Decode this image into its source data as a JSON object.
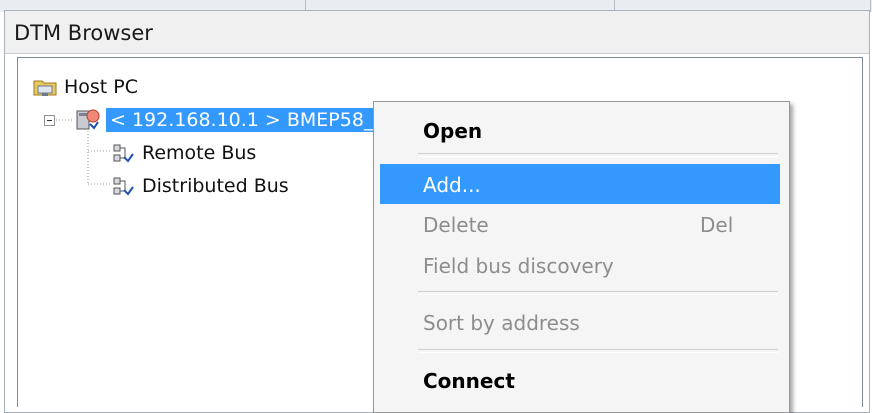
{
  "panel": {
    "title": "DTM Browser"
  },
  "tree": {
    "root": {
      "label": "Host PC",
      "icon": "folder-network-icon"
    },
    "device": {
      "label": "< 192.168.10.1 > BMEP58_ECPU",
      "icon": "plc-device-icon",
      "selected": true
    },
    "children": [
      {
        "label": "Remote Bus",
        "icon": "bus-network-icon"
      },
      {
        "label": "Distributed Bus",
        "icon": "bus-network-icon"
      }
    ]
  },
  "context_menu": {
    "items": [
      {
        "label": "Open",
        "bold": true,
        "enabled": true
      },
      {
        "label": "Add...",
        "enabled": true,
        "highlighted": true
      },
      {
        "label": "Delete",
        "shortcut": "Del",
        "enabled": false
      },
      {
        "label": "Field bus discovery",
        "enabled": false
      },
      {
        "label": "Sort  by address",
        "enabled": false
      },
      {
        "label": "Connect",
        "bold": true,
        "enabled": true
      }
    ]
  },
  "colors": {
    "selection": "#3399ff",
    "menu_bg": "#f5f5f5",
    "disabled_text": "#8d8d8d"
  }
}
